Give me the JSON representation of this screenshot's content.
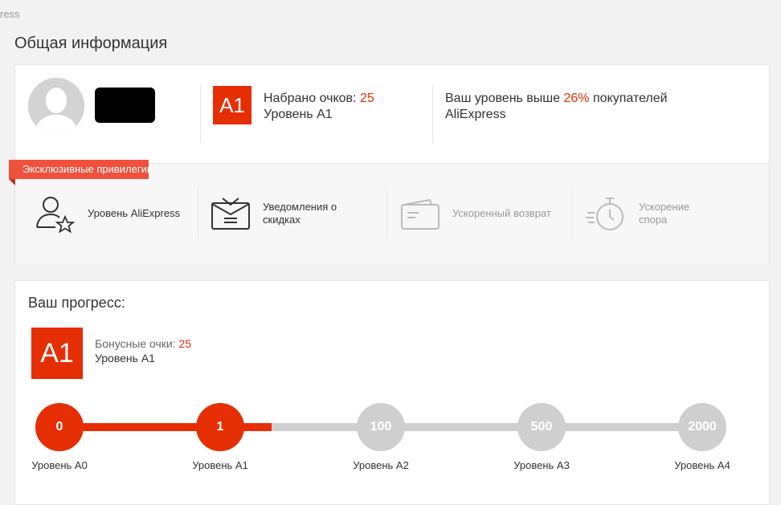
{
  "breadcrumb": "ress",
  "page_title": "Общая информация",
  "profile": {
    "badge": "A1",
    "points_label": "Набрано очков: ",
    "points_value": "25",
    "level_text": "Уровень A1",
    "rank_prefix": "Ваш уровень выше ",
    "rank_percent": "26%",
    "rank_suffix": " покупателей AliExpress"
  },
  "privileges": {
    "ribbon": "Эксклюзивные привилегии",
    "items": [
      {
        "label": "Уровень AliExpress",
        "icon": "user-star-icon",
        "active": true
      },
      {
        "label": "Уведомления о скидках",
        "icon": "envelope-icon",
        "active": true
      },
      {
        "label": "Ускоренный возврат",
        "icon": "wallet-icon",
        "active": false
      },
      {
        "label": "Ускорение спора",
        "icon": "stopwatch-icon",
        "active": false
      }
    ]
  },
  "progress": {
    "title": "Ваш прогресс:",
    "badge": "A1",
    "bonus_label": "Бонусные очки: ",
    "bonus_value": "25",
    "level_text": "Уровень A1",
    "fill_fraction": 0.33,
    "steps": [
      {
        "value": "0",
        "label": "Уровень A0",
        "reached": true
      },
      {
        "value": "1",
        "label": "Уровень A1",
        "reached": true
      },
      {
        "value": "100",
        "label": "Уровень A2",
        "reached": false
      },
      {
        "value": "500",
        "label": "Уровень A3",
        "reached": false
      },
      {
        "value": "2000",
        "label": "Уровень A4",
        "reached": false
      }
    ]
  },
  "colors": {
    "accent": "#e62e04",
    "ribbon": "#f0513c",
    "inactive": "#cfcfcf"
  }
}
